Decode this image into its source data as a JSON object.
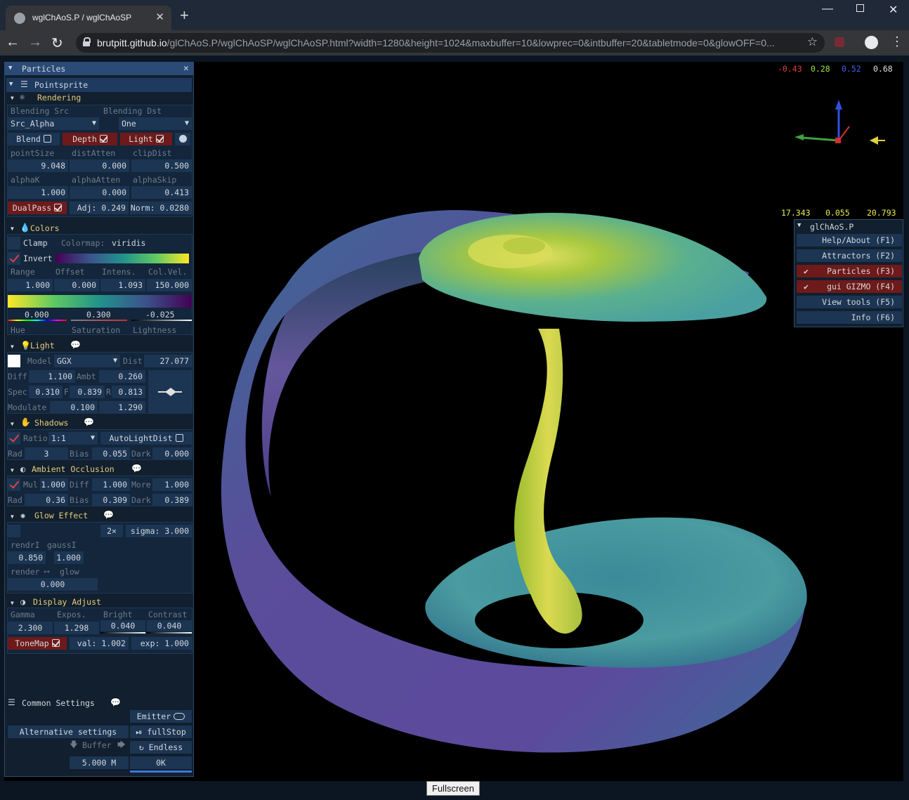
{
  "browser": {
    "tab_title": "wglChAoS.P / wglChAoSP",
    "url_host": "brutpitt.github.io",
    "url_path": "/glChAoS.P/wglChAoSP/wglChAoSP.html?width=1280&height=1024&maxbuffer=10&lowprec=0&intbuffer=20&tabletmode=0&glowOFF=0..."
  },
  "readouts": {
    "quat": [
      "-0.43",
      "0.28",
      "0.52",
      "0.68"
    ],
    "pos": [
      "17.343",
      "0.055",
      "20.793"
    ]
  },
  "panel": {
    "title": "Particles",
    "pointsprite": "Pointsprite",
    "rendering": {
      "title": "Rendering",
      "blend_src_label": "Blending Src",
      "blend_dst_label": "Blending Dst",
      "blend_src": "Src_Alpha",
      "blend_dst": "One",
      "blend": "Blend",
      "depth": "Depth",
      "light": "Light",
      "labels1": [
        "pointSize",
        "distAtten",
        "clipDist"
      ],
      "values1": [
        "9.048",
        "0.000",
        "0.500"
      ],
      "labels2": [
        "alphaK",
        "alphaAtten",
        "alphaSkip"
      ],
      "values2": [
        "1.000",
        "0.000",
        "0.413"
      ],
      "dualpass": "DualPass",
      "adj": "Adj: 0.249",
      "norm": "Norm: 0.0280"
    },
    "colors": {
      "title": "Colors",
      "clamp": "Clamp",
      "colormap_label": "Colormap:",
      "colormap": "viridis",
      "invert": "Invert",
      "labels": [
        "Range",
        "Offset",
        "Intens.",
        "Col.Vel."
      ],
      "values": [
        "1.000",
        "0.000",
        "1.093",
        "150.000"
      ],
      "hsl_values": [
        "0.000",
        "0.300",
        "-0.025"
      ],
      "hsl_labels": [
        "Hue",
        "Saturation",
        "Lightness"
      ]
    },
    "light": {
      "title": "Light",
      "model_label": "Model",
      "model": "GGX",
      "dist_label": "Dist",
      "dist": "27.077",
      "diff_label": "Diff",
      "diff": "1.100",
      "ambt_label": "Ambt",
      "ambt": "0.260",
      "spec_label": "Spec",
      "spec": "0.310",
      "f_label": "F",
      "f": "0.839",
      "r_label": "R",
      "r": "0.813",
      "modulate_label": "Modulate",
      "modulate1": "0.100",
      "modulate2": "1.290"
    },
    "shadows": {
      "title": "Shadows",
      "ratio_label": "Ratio",
      "ratio": "1:1",
      "autolight": "AutoLightDist",
      "rad_label": "Rad",
      "rad": "3",
      "bias_label": "Bias",
      "bias": "0.055",
      "dark_label": "Dark",
      "dark": "0.000"
    },
    "ao": {
      "title": "Ambient Occlusion",
      "mul_label": "Mul",
      "mul": "1.000",
      "diff_label": "Diff",
      "diff": "1.000",
      "more_label": "More",
      "more": "1.000",
      "rad_label": "Rad",
      "rad": "0.36",
      "bias_label": "Bias",
      "bias": "0.309",
      "dark_label": "Dark",
      "dark": "0.389"
    },
    "glow": {
      "title": "Glow Effect",
      "mult": "2×",
      "sigma": "sigma: 3.000",
      "rendr_label": "rendrI",
      "gauss_label": "gaussI",
      "rendr": "0.850",
      "gauss": "1.000",
      "mix_label_left": "render",
      "mix_label_right": "glow",
      "mix": "0.000"
    },
    "display": {
      "title": "Display Adjust",
      "labels": [
        "Gamma",
        "Expos.",
        "Bright",
        "Contrast"
      ],
      "values": [
        "2.300",
        "1.298",
        "0.040",
        "0.040"
      ],
      "tonemap": "ToneMap",
      "val": "val: 1.002",
      "exp": "exp: 1.000"
    },
    "common": {
      "title": "Common Settings",
      "emitter": "Emitter",
      "alt": "Alternative settings",
      "fullstop": "fullStop",
      "buffer": "Buffer",
      "endless": "Endless",
      "count": "5.000 M",
      "progress": "0K"
    }
  },
  "menu": {
    "title": "glChAoS.P",
    "items": [
      {
        "label": "Help/About  (F1)"
      },
      {
        "label": "Attractors  (F2)"
      },
      {
        "label": "Particles  (F3)"
      },
      {
        "label": "gui GIZMO  (F4)"
      },
      {
        "label": "View tools  (F5)"
      },
      {
        "label": "Info  (F6)"
      }
    ]
  },
  "fullscreen_label": "Fullscreen",
  "colors": {
    "panel_bg": "#122030",
    "field": "#1c3553",
    "active": "#6e1a1a",
    "header_text": "#e4cc7c"
  }
}
